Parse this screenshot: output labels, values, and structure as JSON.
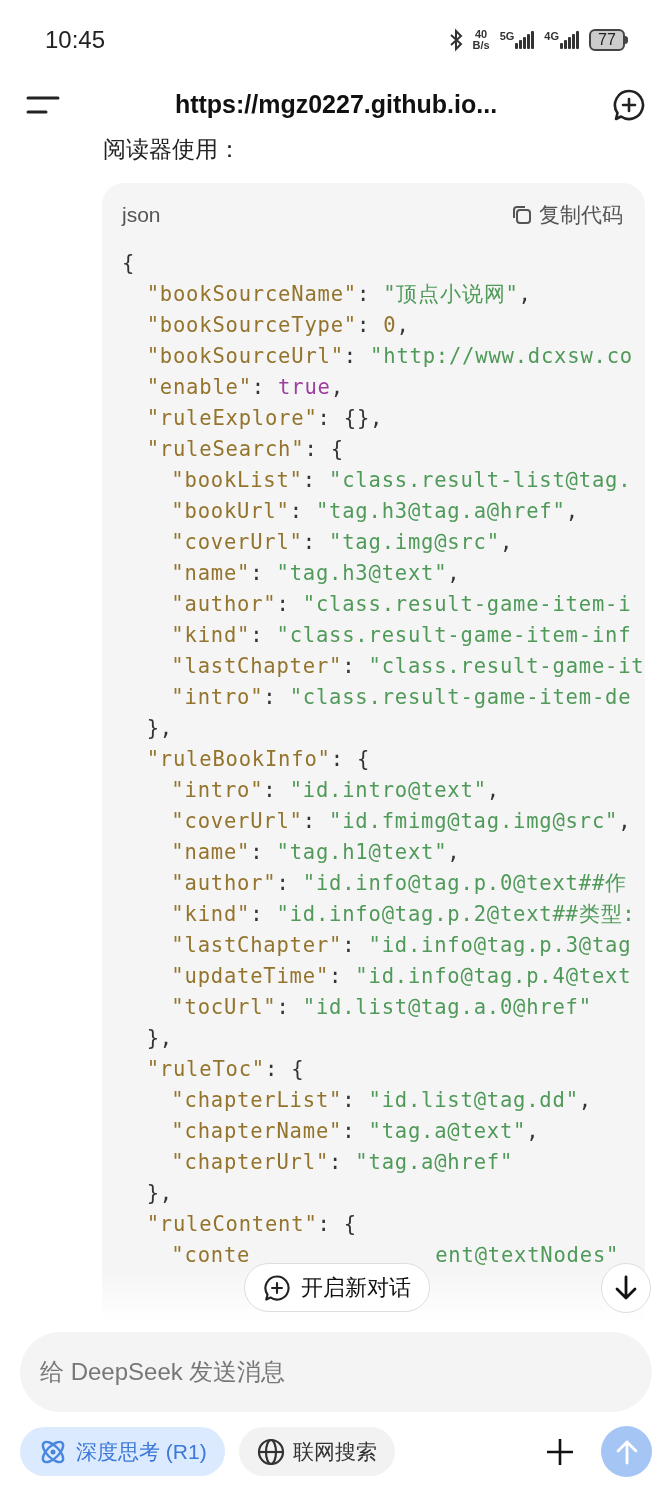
{
  "status_bar": {
    "time": "10:45",
    "net_speed": [
      "40",
      "B/s"
    ],
    "signals": [
      {
        "label": "5G"
      },
      {
        "label": "4G"
      }
    ],
    "battery": "77"
  },
  "header": {
    "title": "https://mgz0227.github.io..."
  },
  "message": {
    "text": "阅读器使用："
  },
  "code_block": {
    "language": "json",
    "copy_label": "复制代码",
    "lines": [
      {
        "tokens": [
          {
            "kind": "punct",
            "text": "{"
          }
        ],
        "children": [
          {
            "tokens": [
              {
                "kind": "key",
                "text": "\"bookSourceName\""
              },
              {
                "kind": "punct",
                "text": ": "
              },
              {
                "kind": "string",
                "text": "\"顶点小说网\""
              },
              {
                "kind": "punct",
                "text": ","
              }
            ]
          },
          {
            "tokens": [
              {
                "kind": "key",
                "text": "\"bookSourceType\""
              },
              {
                "kind": "punct",
                "text": ": "
              },
              {
                "kind": "number",
                "text": "0"
              },
              {
                "kind": "punct",
                "text": ","
              }
            ]
          },
          {
            "tokens": [
              {
                "kind": "key",
                "text": "\"bookSourceUrl\""
              },
              {
                "kind": "punct",
                "text": ": "
              },
              {
                "kind": "string",
                "text": "\"http://www.dcxsw.co"
              }
            ]
          },
          {
            "tokens": [
              {
                "kind": "key",
                "text": "\"enable\""
              },
              {
                "kind": "punct",
                "text": ": "
              },
              {
                "kind": "literal",
                "text": "true"
              },
              {
                "kind": "punct",
                "text": ","
              }
            ]
          },
          {
            "tokens": [
              {
                "kind": "key",
                "text": "\"ruleExplore\""
              },
              {
                "kind": "punct",
                "text": ": {},"
              }
            ]
          },
          {
            "tokens": [
              {
                "kind": "key",
                "text": "\"ruleSearch\""
              },
              {
                "kind": "punct",
                "text": ": {"
              }
            ],
            "children": [
              {
                "tokens": [
                  {
                    "kind": "key",
                    "text": "\"bookList\""
                  },
                  {
                    "kind": "punct",
                    "text": ": "
                  },
                  {
                    "kind": "string",
                    "text": "\"class.result-list@tag."
                  }
                ]
              },
              {
                "tokens": [
                  {
                    "kind": "key",
                    "text": "\"bookUrl\""
                  },
                  {
                    "kind": "punct",
                    "text": ": "
                  },
                  {
                    "kind": "string",
                    "text": "\"tag.h3@tag.a@href\""
                  },
                  {
                    "kind": "punct",
                    "text": ","
                  }
                ]
              },
              {
                "tokens": [
                  {
                    "kind": "key",
                    "text": "\"coverUrl\""
                  },
                  {
                    "kind": "punct",
                    "text": ": "
                  },
                  {
                    "kind": "string",
                    "text": "\"tag.img@src\""
                  },
                  {
                    "kind": "punct",
                    "text": ","
                  }
                ]
              },
              {
                "tokens": [
                  {
                    "kind": "key",
                    "text": "\"name\""
                  },
                  {
                    "kind": "punct",
                    "text": ": "
                  },
                  {
                    "kind": "string",
                    "text": "\"tag.h3@text\""
                  },
                  {
                    "kind": "punct",
                    "text": ","
                  }
                ]
              },
              {
                "tokens": [
                  {
                    "kind": "key",
                    "text": "\"author\""
                  },
                  {
                    "kind": "punct",
                    "text": ": "
                  },
                  {
                    "kind": "string",
                    "text": "\"class.result-game-item-i"
                  }
                ]
              },
              {
                "tokens": [
                  {
                    "kind": "key",
                    "text": "\"kind\""
                  },
                  {
                    "kind": "punct",
                    "text": ": "
                  },
                  {
                    "kind": "string",
                    "text": "\"class.result-game-item-inf"
                  }
                ]
              },
              {
                "tokens": [
                  {
                    "kind": "key",
                    "text": "\"lastChapter\""
                  },
                  {
                    "kind": "punct",
                    "text": ": "
                  },
                  {
                    "kind": "string",
                    "text": "\"class.result-game-it"
                  }
                ]
              },
              {
                "tokens": [
                  {
                    "kind": "key",
                    "text": "\"intro\""
                  },
                  {
                    "kind": "punct",
                    "text": ": "
                  },
                  {
                    "kind": "string",
                    "text": "\"class.result-game-item-de"
                  }
                ]
              }
            ]
          },
          {
            "tokens": [
              {
                "kind": "punct",
                "text": "},"
              }
            ]
          },
          {
            "tokens": [
              {
                "kind": "key",
                "text": "\"ruleBookInfo\""
              },
              {
                "kind": "punct",
                "text": ": {"
              }
            ],
            "children": [
              {
                "tokens": [
                  {
                    "kind": "key",
                    "text": "\"intro\""
                  },
                  {
                    "kind": "punct",
                    "text": ": "
                  },
                  {
                    "kind": "string",
                    "text": "\"id.intro@text\""
                  },
                  {
                    "kind": "punct",
                    "text": ","
                  }
                ]
              },
              {
                "tokens": [
                  {
                    "kind": "key",
                    "text": "\"coverUrl\""
                  },
                  {
                    "kind": "punct",
                    "text": ": "
                  },
                  {
                    "kind": "string",
                    "text": "\"id.fmimg@tag.img@src\""
                  },
                  {
                    "kind": "punct",
                    "text": ","
                  }
                ]
              },
              {
                "tokens": [
                  {
                    "kind": "key",
                    "text": "\"name\""
                  },
                  {
                    "kind": "punct",
                    "text": ": "
                  },
                  {
                    "kind": "string",
                    "text": "\"tag.h1@text\""
                  },
                  {
                    "kind": "punct",
                    "text": ","
                  }
                ]
              },
              {
                "tokens": [
                  {
                    "kind": "key",
                    "text": "\"author\""
                  },
                  {
                    "kind": "punct",
                    "text": ": "
                  },
                  {
                    "kind": "string",
                    "text": "\"id.info@tag.p.0@text##作"
                  }
                ]
              },
              {
                "tokens": [
                  {
                    "kind": "key",
                    "text": "\"kind\""
                  },
                  {
                    "kind": "punct",
                    "text": ": "
                  },
                  {
                    "kind": "string",
                    "text": "\"id.info@tag.p.2@text##类型:"
                  }
                ]
              },
              {
                "tokens": [
                  {
                    "kind": "key",
                    "text": "\"lastChapter\""
                  },
                  {
                    "kind": "punct",
                    "text": ": "
                  },
                  {
                    "kind": "string",
                    "text": "\"id.info@tag.p.3@tag"
                  }
                ]
              },
              {
                "tokens": [
                  {
                    "kind": "key",
                    "text": "\"updateTime\""
                  },
                  {
                    "kind": "punct",
                    "text": ": "
                  },
                  {
                    "kind": "string",
                    "text": "\"id.info@tag.p.4@text"
                  }
                ]
              },
              {
                "tokens": [
                  {
                    "kind": "key",
                    "text": "\"tocUrl\""
                  },
                  {
                    "kind": "punct",
                    "text": ": "
                  },
                  {
                    "kind": "string",
                    "text": "\"id.list@tag.a.0@href\""
                  }
                ]
              }
            ]
          },
          {
            "tokens": [
              {
                "kind": "punct",
                "text": "},"
              }
            ]
          },
          {
            "tokens": [
              {
                "kind": "key",
                "text": "\"ruleToc\""
              },
              {
                "kind": "punct",
                "text": ": {"
              }
            ],
            "children": [
              {
                "tokens": [
                  {
                    "kind": "key",
                    "text": "\"chapterList\""
                  },
                  {
                    "kind": "punct",
                    "text": ": "
                  },
                  {
                    "kind": "string",
                    "text": "\"id.list@tag.dd\""
                  },
                  {
                    "kind": "punct",
                    "text": ","
                  }
                ]
              },
              {
                "tokens": [
                  {
                    "kind": "key",
                    "text": "\"chapterName\""
                  },
                  {
                    "kind": "punct",
                    "text": ": "
                  },
                  {
                    "kind": "string",
                    "text": "\"tag.a@text\""
                  },
                  {
                    "kind": "punct",
                    "text": ","
                  }
                ]
              },
              {
                "tokens": [
                  {
                    "kind": "key",
                    "text": "\"chapterUrl\""
                  },
                  {
                    "kind": "punct",
                    "text": ": "
                  },
                  {
                    "kind": "string",
                    "text": "\"tag.a@href\""
                  }
                ]
              }
            ]
          },
          {
            "tokens": [
              {
                "kind": "punct",
                "text": "},"
              }
            ]
          },
          {
            "tokens": [
              {
                "kind": "key",
                "text": "\"ruleContent\""
              },
              {
                "kind": "punct",
                "text": ": {"
              }
            ],
            "children": [
              {
                "covered": true,
                "tokens": [
                  {
                    "kind": "key",
                    "text": "\"conte"
                  },
                  {
                    "kind": "string",
                    "text": "ent@textNodes\""
                  }
                ]
              }
            ]
          }
        ]
      }
    ]
  },
  "new_chat_button": {
    "label": "开启新对话"
  },
  "composer": {
    "placeholder": "给 DeepSeek 发送消息",
    "chips": [
      {
        "label": "深度思考 (R1)",
        "selected": true,
        "kind": "think"
      },
      {
        "label": "联网搜索",
        "selected": false,
        "kind": "web"
      }
    ],
    "send_disabled": true
  }
}
